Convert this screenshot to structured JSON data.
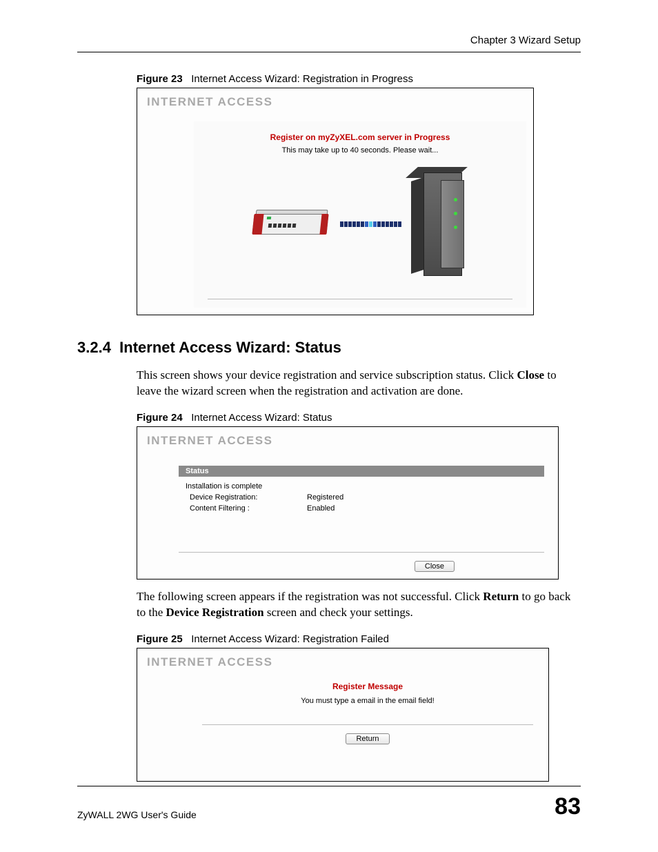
{
  "header": {
    "chapter": "Chapter 3 Wizard Setup"
  },
  "fig23": {
    "caption_label": "Figure 23",
    "caption_text": "Internet Access Wizard: Registration in Progress",
    "panel_title": "INTERNET ACCESS",
    "red_title": "Register on myZyXEL.com server in Progress",
    "wait_text": "This may take up to 40 seconds. Please wait..."
  },
  "section": {
    "number": "3.2.4",
    "title": "Internet Access Wizard: Status",
    "para1_a": "This screen shows your device registration and service subscription status. Click ",
    "para1_bold": "Close",
    "para1_b": " to leave the wizard screen when the registration and activation are done."
  },
  "fig24": {
    "caption_label": "Figure 24",
    "caption_text": "Internet Access Wizard: Status",
    "panel_title": "INTERNET ACCESS",
    "status_tab": "Status",
    "complete": "Installation is complete",
    "rows": [
      {
        "k": "Device Registration:",
        "v": "Registered"
      },
      {
        "k": "Content Filtering :",
        "v": "Enabled"
      }
    ],
    "close_btn": "Close"
  },
  "para2": {
    "a": "The following screen appears if the registration was not successful. Click ",
    "b1": "Return",
    "b": " to go back to the ",
    "b2": "Device Registration",
    "c": " screen and check your settings."
  },
  "fig25": {
    "caption_label": "Figure 25",
    "caption_text": "Internet Access Wizard: Registration Failed",
    "panel_title": "INTERNET ACCESS",
    "red_title": "Register Message",
    "msg": "You must type a email in the email field!",
    "return_btn": "Return"
  },
  "footer": {
    "guide": "ZyWALL 2WG User's Guide",
    "page": "83"
  }
}
